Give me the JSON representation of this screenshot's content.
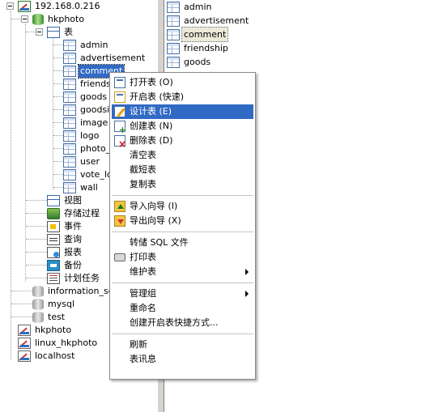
{
  "left_tree": {
    "server": "192.168.0.216",
    "database": "hkphoto",
    "tables_group": "表",
    "tables": [
      "admin",
      "advertisement",
      "comment",
      "friendsh",
      "goods",
      "goodsin",
      "image",
      "logo",
      "photo_",
      "user",
      "vote_lo",
      "wall"
    ],
    "selected_table": "comment",
    "groups": [
      "视图",
      "存储过程",
      "事件",
      "查询",
      "报表",
      "备份",
      "计划任务"
    ],
    "other_databases": [
      "information_sch",
      "mysql",
      "test"
    ],
    "connections": [
      "hkphoto",
      "linux_hkphoto",
      "localhost"
    ]
  },
  "right_list": {
    "items": [
      "admin",
      "advertisement",
      "comment",
      "friendship",
      "goods"
    ],
    "highlighted": "comment"
  },
  "context_menu": {
    "open_table": "打开表 (O)",
    "open_table_quick": "开启表 (快速)",
    "design_table": "设计表 (E)",
    "new_table": "创建表 (N)",
    "delete_table": "删除表 (D)",
    "empty_table": "清空表",
    "truncate_table": "截短表",
    "duplicate_table": "复制表",
    "import_wizard": "导入向导 (I)",
    "export_wizard": "导出向导 (X)",
    "dump_sql": "转储 SQL 文件",
    "print_table": "打印表",
    "maintain_table": "维护表",
    "manage_group": "管理组",
    "rename": "重命名",
    "create_shortcut": "创建开启表快捷方式...",
    "refresh": "刷新",
    "table_info": "表讯息",
    "active_item": "设计表 (E)"
  }
}
